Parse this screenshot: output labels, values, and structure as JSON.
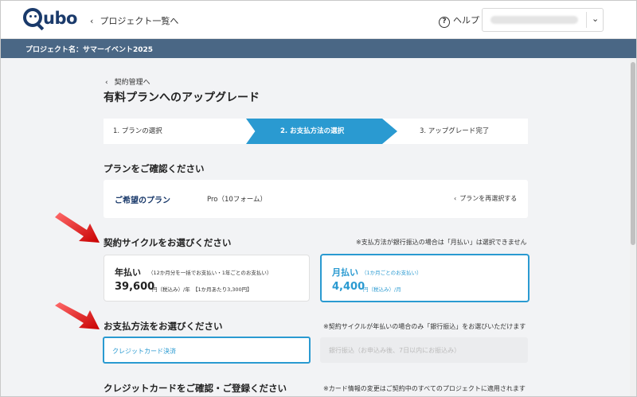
{
  "header": {
    "logo": "Qubo",
    "back_link": "プロジェクト一覧へ",
    "help": "ヘルプ"
  },
  "project_bar": {
    "label": "プロジェクト名：サマーイベント2025"
  },
  "breadcrumb": "契約管理へ",
  "page_title": "有料プランへのアップグレード",
  "steps": [
    {
      "label": "1. プランの選択"
    },
    {
      "label": "2. お支払方法の選択"
    },
    {
      "label": "3. アップグレード完了"
    }
  ],
  "plan_section": {
    "title": "プランをご確認ください",
    "label": "ご希望のプラン",
    "value": "Pro（10フォーム）",
    "reselect": "プランを再選択する"
  },
  "cycle_section": {
    "title": "契約サイクルをお選びください",
    "note": "※支払方法が銀行振込の場合は「月払い」は選択できません",
    "annual": {
      "title": "年払い",
      "sub": "（12か月分を一括でお支払い・1年ごとのお支払い）",
      "price": "39,600",
      "tax": "円（税込み）/年　【1か月あたり3,300円】"
    },
    "monthly": {
      "title": "月払い",
      "sub": "（1か月ごとのお支払い）",
      "price": "4,400",
      "tax": "円（税込み）/月"
    }
  },
  "payment_section": {
    "title": "お支払方法をお選びください",
    "note": "※契約サイクルが年払いの場合のみ「銀行振込」をお選びいただけます",
    "credit_card": "クレジットカード決済",
    "bank": "銀行振込（お申込み後、7日以内にお振込み）"
  },
  "card_section": {
    "title": "クレジットカードをご確認・ご登録ください",
    "note": "※カード情報の変更はご契約中のすべてのプロジェクトに適用されます"
  },
  "colors": {
    "accent": "#2a9ad1",
    "project_bar": "#4a6785",
    "brand": "#1a3a6b",
    "arrow": "#e02020"
  }
}
